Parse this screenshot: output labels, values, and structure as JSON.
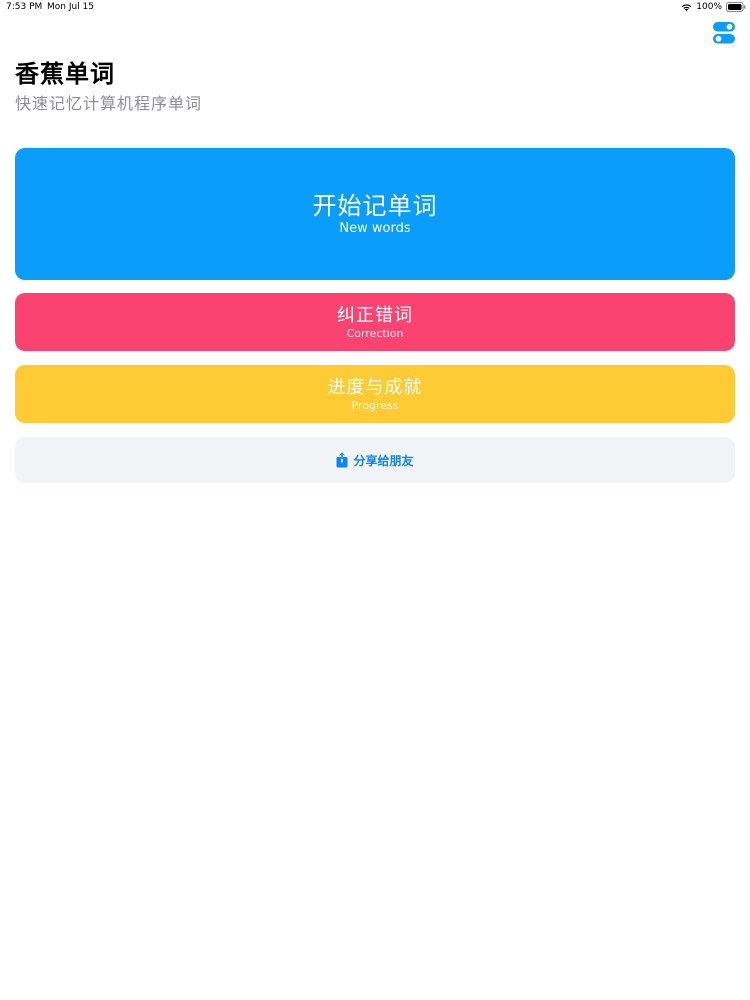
{
  "status_bar": {
    "time": "7:53 PM",
    "date": "Mon Jul 15",
    "battery": "100%"
  },
  "header": {
    "title": "香蕉单词",
    "subtitle": "快速记忆计算机程序单词"
  },
  "buttons": {
    "new_words": {
      "label_zh": "开始记单词",
      "label_en": "New words",
      "color": "#0a9dfa"
    },
    "correction": {
      "label_zh": "纠正错词",
      "label_en": "Correction",
      "color": "#fb4372"
    },
    "progress": {
      "label_zh": "进度与成就",
      "label_en": "Progress",
      "color": "#fecb34"
    },
    "share": {
      "label": "分享给朋友",
      "icon": "share-icon",
      "color": "#0a84ff",
      "background": "#f1f3f6"
    }
  },
  "icons": {
    "settings": "toggle-settings-icon",
    "wifi": "wifi-icon",
    "battery": "battery-icon"
  },
  "colors": {
    "accent": "#0a9dfa",
    "subtitle_gray": "#8e8e93"
  }
}
